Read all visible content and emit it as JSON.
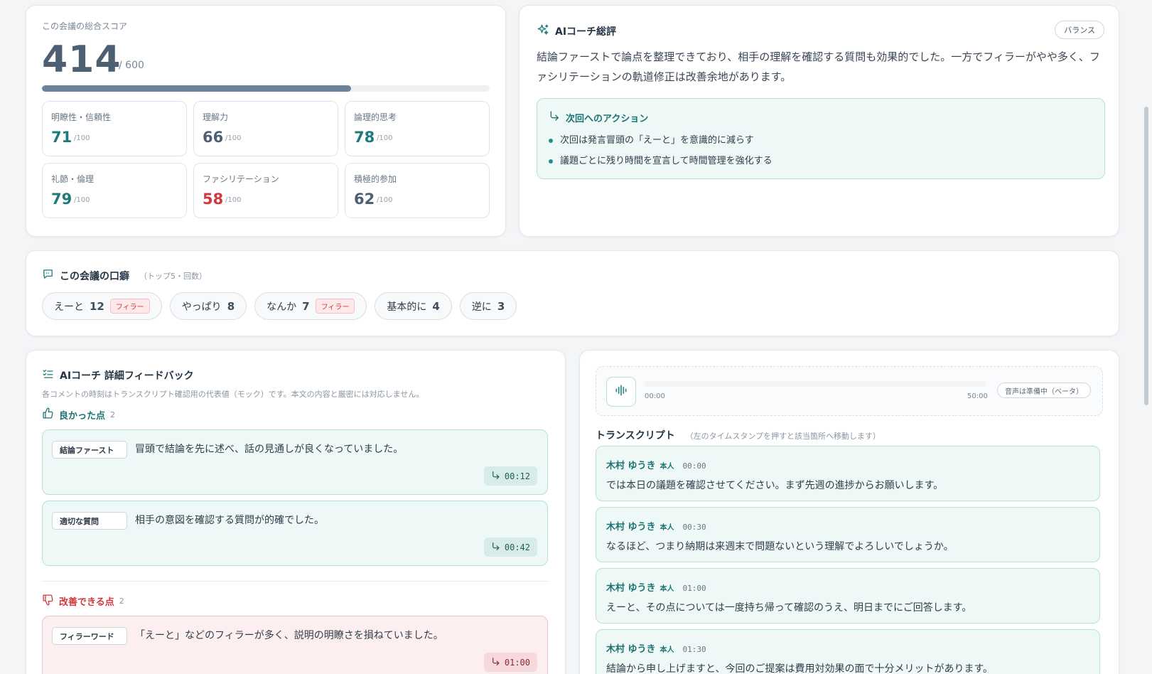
{
  "score": {
    "label": "この会議の総合スコア",
    "value": "414",
    "max": "/ 600",
    "progress_fraction": 0.69,
    "metrics": [
      {
        "label": "明瞭性・信頼性",
        "value": "71",
        "max": "/100",
        "tone": "teal"
      },
      {
        "label": "理解力",
        "value": "66",
        "max": "/100",
        "tone": "gray"
      },
      {
        "label": "論理的思考",
        "value": "78",
        "max": "/100",
        "tone": "teal"
      },
      {
        "label": "礼節・倫理",
        "value": "79",
        "max": "/100",
        "tone": "teal"
      },
      {
        "label": "ファシリテーション",
        "value": "58",
        "max": "/100",
        "tone": "red"
      },
      {
        "label": "積極的参加",
        "value": "62",
        "max": "/100",
        "tone": "gray"
      }
    ]
  },
  "coach": {
    "title": "AIコーチ総評",
    "badge": "バランス",
    "body": "結論ファーストで論点を整理できており、相手の理解を確認する質問も効果的でした。一方でフィラーがやや多く、ファシリテーションの軌道修正は改善余地があります。",
    "action_title": "次回へのアクション",
    "actions": [
      "次回は発言冒頭の「えーと」を意識的に減らす",
      "議題ごとに残り時間を宣言して時間管理を強化する"
    ]
  },
  "habits": {
    "title": "この会議の口癖",
    "subtitle": "（トップ5・回数）",
    "filler_label": "フィラー",
    "items": [
      {
        "word": "えーと",
        "count": "12",
        "filler": true
      },
      {
        "word": "やっぱり",
        "count": "8",
        "filler": false
      },
      {
        "word": "なんか",
        "count": "7",
        "filler": true
      },
      {
        "word": "基本的に",
        "count": "4",
        "filler": false
      },
      {
        "word": "逆に",
        "count": "3",
        "filler": false
      }
    ]
  },
  "feedback": {
    "title": "AIコーチ 詳細フィードバック",
    "note": "各コメントの時刻はトランスクリプト確認用の代表値（モック）です。本文の内容と厳密には対応しません。",
    "good_title": "良かった点",
    "good_count": "2",
    "good": [
      {
        "tag": "結論ファースト",
        "text": "冒頭で結論を先に述べ、話の見通しが良くなっていました。",
        "time": "00:12"
      },
      {
        "tag": "適切な質問",
        "text": "相手の意図を確認する質問が的確でした。",
        "time": "00:42"
      }
    ],
    "bad_title": "改善できる点",
    "bad_count": "2",
    "bad": [
      {
        "tag": "フィラーワード",
        "text": "「えーと」などのフィラーが多く、説明の明瞭さを損ねていました。",
        "time": "01:00"
      }
    ]
  },
  "audio": {
    "start": "00:00",
    "end": "50:00",
    "badge": "音声は準備中（ベータ）"
  },
  "transcript": {
    "title": "トランスクリプト",
    "subtitle": "（左のタイムスタンプを押すと該当箇所へ移動します）",
    "entries": [
      {
        "speaker": "木村 ゆうき",
        "self": "本人",
        "time": "00:00",
        "text": "では本日の議題を確認させてください。まず先週の進捗からお願いします。"
      },
      {
        "speaker": "木村 ゆうき",
        "self": "本人",
        "time": "00:30",
        "text": "なるほど、つまり納期は来週末で問題ないという理解でよろしいでしょうか。"
      },
      {
        "speaker": "木村 ゆうき",
        "self": "本人",
        "time": "01:00",
        "text": "えーと、その点については一度持ち帰って確認のうえ、明日までにご回答します。"
      },
      {
        "speaker": "木村 ゆうき",
        "self": "本人",
        "time": "01:30",
        "text": "結論から申し上げますと、今回のご提案は費用対効果の面で十分メリットがあります。"
      }
    ]
  },
  "colors": {
    "accent": "#1f7a7a",
    "danger": "#d0383e",
    "good_bg": "#eef8f7",
    "bad_bg": "#fdeff0"
  },
  "icons": [
    "sparkle-icon",
    "return-arrow-icon",
    "speech-bubble-icon",
    "checklist-icon",
    "thumbs-up-icon",
    "thumbs-down-icon",
    "waveform-icon"
  ]
}
